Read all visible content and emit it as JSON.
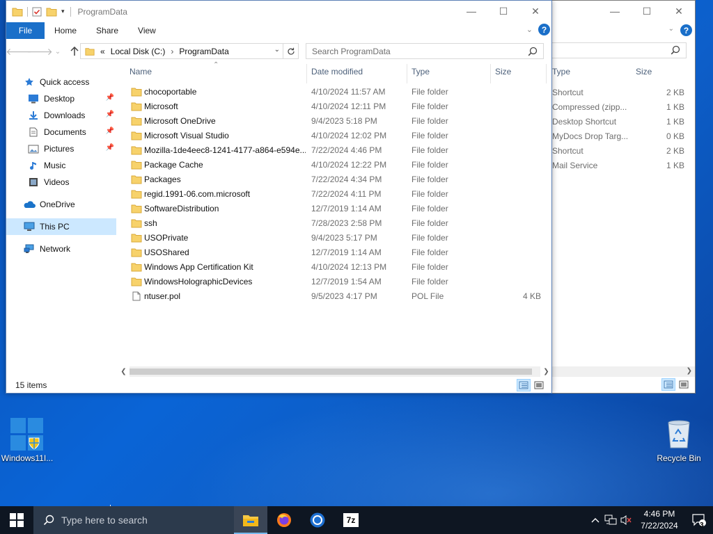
{
  "window": {
    "title": "ProgramData",
    "tabs": [
      "File",
      "Home",
      "Share",
      "View"
    ],
    "help_label": "?"
  },
  "navigation": {
    "address": {
      "overflow": "«",
      "crumbs": [
        "Local Disk (C:)",
        "ProgramData"
      ]
    },
    "search_placeholder": "Search ProgramData"
  },
  "nav_pane": [
    {
      "label": "Quick access",
      "icon": "star-icon"
    },
    {
      "label": "Desktop",
      "icon": "desktop-icon",
      "pinned": true
    },
    {
      "label": "Downloads",
      "icon": "download-icon",
      "pinned": true
    },
    {
      "label": "Documents",
      "icon": "document-icon",
      "pinned": true
    },
    {
      "label": "Pictures",
      "icon": "pictures-icon",
      "pinned": true
    },
    {
      "label": "Music",
      "icon": "music-icon"
    },
    {
      "label": "Videos",
      "icon": "video-icon"
    },
    {
      "label": "OneDrive",
      "icon": "cloud-icon"
    },
    {
      "label": "This PC",
      "icon": "computer-icon",
      "selected": true
    },
    {
      "label": "Network",
      "icon": "network-icon"
    }
  ],
  "columns": {
    "name": "Name",
    "date": "Date modified",
    "type": "Type",
    "size": "Size"
  },
  "files": [
    {
      "name": "chocoportable",
      "date": "4/10/2024 11:57 AM",
      "type": "File folder",
      "size": ""
    },
    {
      "name": "Microsoft",
      "date": "4/10/2024 12:11 PM",
      "type": "File folder",
      "size": ""
    },
    {
      "name": "Microsoft OneDrive",
      "date": "9/4/2023 5:18 PM",
      "type": "File folder",
      "size": ""
    },
    {
      "name": "Microsoft Visual Studio",
      "date": "4/10/2024 12:02 PM",
      "type": "File folder",
      "size": ""
    },
    {
      "name": "Mozilla-1de4eec8-1241-4177-a864-e594e...",
      "date": "7/22/2024 4:46 PM",
      "type": "File folder",
      "size": ""
    },
    {
      "name": "Package Cache",
      "date": "4/10/2024 12:22 PM",
      "type": "File folder",
      "size": ""
    },
    {
      "name": "Packages",
      "date": "7/22/2024 4:34 PM",
      "type": "File folder",
      "size": ""
    },
    {
      "name": "regid.1991-06.com.microsoft",
      "date": "7/22/2024 4:11 PM",
      "type": "File folder",
      "size": ""
    },
    {
      "name": "SoftwareDistribution",
      "date": "12/7/2019 1:14 AM",
      "type": "File folder",
      "size": ""
    },
    {
      "name": "ssh",
      "date": "7/28/2023 2:58 PM",
      "type": "File folder",
      "size": ""
    },
    {
      "name": "USOPrivate",
      "date": "9/4/2023 5:17 PM",
      "type": "File folder",
      "size": ""
    },
    {
      "name": "USOShared",
      "date": "12/7/2019 1:14 AM",
      "type": "File folder",
      "size": ""
    },
    {
      "name": "Windows App Certification Kit",
      "date": "4/10/2024 12:13 PM",
      "type": "File folder",
      "size": ""
    },
    {
      "name": "WindowsHolographicDevices",
      "date": "12/7/2019 1:54 AM",
      "type": "File folder",
      "size": ""
    },
    {
      "name": "ntuser.pol",
      "date": "9/5/2023 4:17 PM",
      "type": "POL File",
      "size": "4 KB"
    }
  ],
  "status": {
    "items": "15 items"
  },
  "back_window": {
    "columns": {
      "type": "Type",
      "size": "Size"
    },
    "rows": [
      {
        "type": "Shortcut",
        "size": "2 KB"
      },
      {
        "type": "Compressed (zipp...",
        "size": "1 KB"
      },
      {
        "type": "Desktop Shortcut",
        "size": "1 KB"
      },
      {
        "type": "MyDocs Drop Targ...",
        "size": "0 KB"
      },
      {
        "type": "Shortcut",
        "size": "2 KB"
      },
      {
        "type": "Mail Service",
        "size": "1 KB"
      }
    ]
  },
  "desktop_icons": {
    "windows11": "Windows11I...",
    "recycle_bin": "Recycle Bin"
  },
  "taskbar": {
    "search_placeholder": "Type here to search",
    "apps": [
      "file-explorer-icon",
      "firefox-icon",
      "chrome-icon",
      "7zip-icon"
    ],
    "sevenzip_label": "7z",
    "clock_time": "4:46 PM",
    "clock_date": "7/22/2024",
    "notification_count": "3"
  },
  "colors": {
    "accent": "#1a6fc9",
    "folder": "#f7d26b",
    "selection": "#cce8ff",
    "taskbar": "#0e1622"
  }
}
